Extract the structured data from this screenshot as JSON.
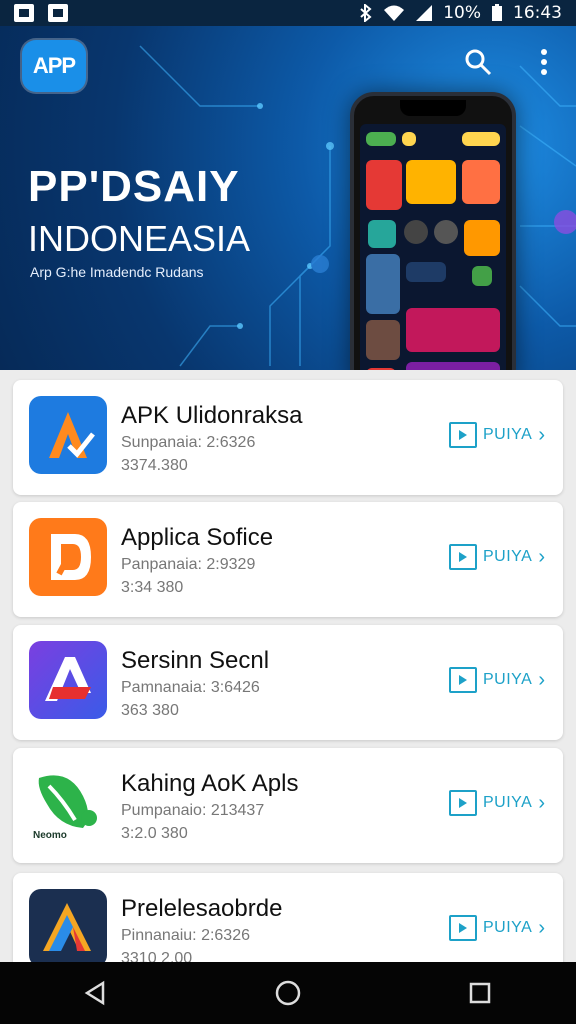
{
  "status_bar": {
    "battery": "10%",
    "time": "16:43",
    "icons": [
      "image-icon",
      "image-icon",
      "bluetooth-icon",
      "wifi-icon",
      "signal-icon",
      "battery-icon"
    ]
  },
  "hero": {
    "logo_text": "APP",
    "title": "PP'DSAIY",
    "subtitle": "INDONEASIA",
    "tagline": "Arp G:he Imadendc Rudans",
    "actions": [
      "search-icon",
      "more-vert-icon"
    ]
  },
  "apps": [
    {
      "name": "APK Ulidonraksa",
      "meta1": "Sunpanaia: 2:6326",
      "meta2": "3374.380",
      "action_label": "PUIYA",
      "icon_colors": [
        "#1e7be0",
        "#ff8a1e"
      ],
      "icon_text": ""
    },
    {
      "name": "Applica Sofice",
      "meta1": "Panpanaia: 2:9329",
      "meta2": "3:34 380",
      "action_label": "PUIYA",
      "icon_colors": [
        "#ff7a1a",
        "#ffffff"
      ],
      "icon_text": ""
    },
    {
      "name": "Sersinn Secnl",
      "meta1": "Pamnanaia: 3:6426",
      "meta2": "363 380",
      "action_label": "PUIYA",
      "icon_colors": [
        "#7b3fe0",
        "#e63030"
      ],
      "icon_text": ""
    },
    {
      "name": "Kahing AoK Apls",
      "meta1": "Pumpanaio: 213437",
      "meta2": "3:2.0 380",
      "action_label": "PUIYA",
      "icon_colors": [
        "#2db34a",
        "#ffffff"
      ],
      "icon_text": "Neomo"
    },
    {
      "name": "Prelelesaobrde",
      "meta1": "Pinnanaiu: 2:6326",
      "meta2": "3310 2.00",
      "action_label": "PUIYA",
      "icon_colors": [
        "#1b2f50",
        "#f5a623"
      ],
      "icon_text": ""
    }
  ],
  "nav": [
    "back-icon",
    "home-icon",
    "recents-icon"
  ]
}
